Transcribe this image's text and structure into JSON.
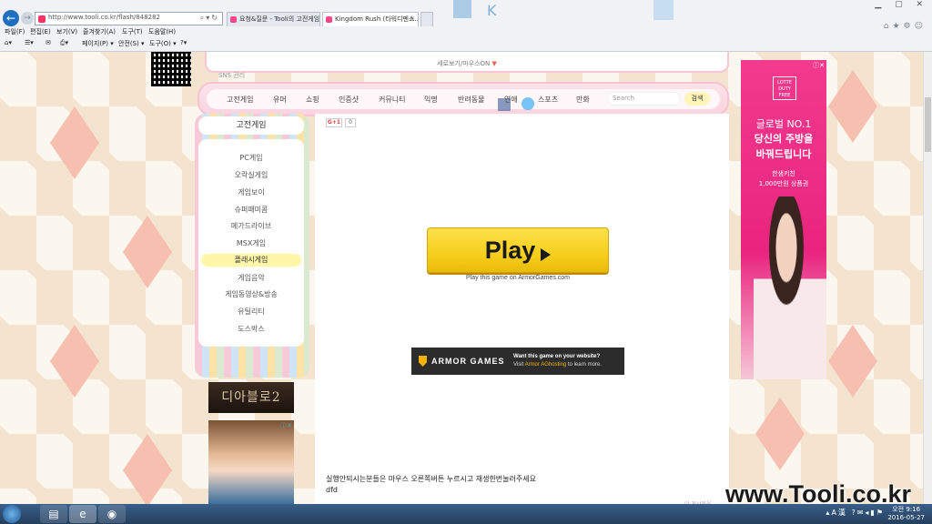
{
  "browser": {
    "url": "http://www.tooli.co.kr/flash/848282",
    "tabs": [
      {
        "label": "요청&질문 - Tooli의 고전게임..."
      },
      {
        "label": "Kingdom Rush (타워디펜스..."
      }
    ],
    "menu": [
      "파일(F)",
      "편집(E)",
      "보기(V)",
      "즐겨찾기(A)",
      "도구(T)",
      "도움말(H)"
    ],
    "toolbar": [
      "페이지(P) ▾",
      "안전(S) ▾",
      "도구(O) ▾"
    ]
  },
  "header": {
    "mobile_link": "세로보기/마우스ON",
    "sns_text": "SNS 관리"
  },
  "nav": {
    "items": [
      "고전게임",
      "유머",
      "쇼핑",
      "인증샷",
      "커뮤니티",
      "익명",
      "반려동물",
      "연애",
      "스포츠",
      "만화"
    ],
    "search_placeholder": "Search",
    "search_button": "검색"
  },
  "sidebar": {
    "title": "고전게임",
    "items": [
      "PC게임",
      "오락실게임",
      "게임보이",
      "슈퍼패미콤",
      "메가드라이브",
      "MSX게임",
      "플래시게임",
      "게임음악",
      "게임동영상&방송",
      "유틸리티",
      "도스박스"
    ],
    "active_index": 6,
    "banner_text": "디아블로2"
  },
  "main": {
    "gplus_label": "G+1",
    "gplus_count": "0",
    "play_label": "Play",
    "play_sub": "Play this game on ArmorGames.com",
    "armor_brand": "ARMOR GAMES",
    "armor_want": "Want this game on your website?",
    "armor_visit_prefix": "Visit ",
    "armor_visit_link": "Armor AGhosting",
    "armor_visit_suffix": " to learn more.",
    "instruction": "실행안되시는분들은 마우스 오른쪽버튼 누르시고 재생한번눌러주세요",
    "note": "dfd",
    "footer": "이 게시물을"
  },
  "ad_right": {
    "logo": "LOTTE DUTY FREE",
    "line1": "글로벌 NO.1",
    "line2": "당신의 주방을",
    "line3": "바꿔드립니다",
    "line4": "한샘키친",
    "line5": "1,000만원 상품권"
  },
  "watermark": "www.Tooli.co.kr",
  "taskbar": {
    "time": "오전 9:16",
    "date": "2016-05-27"
  }
}
